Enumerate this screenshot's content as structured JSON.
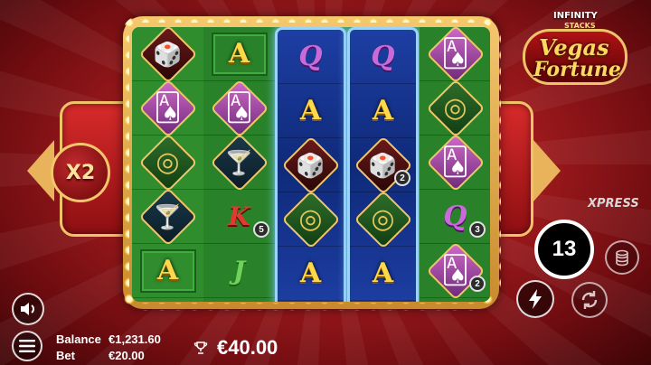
{
  "game": {
    "logo_infinity": "INFINITY",
    "logo_stacks": "STACKS",
    "logo_line1": "Vegas",
    "logo_line2": "Fortune",
    "multiplier": "X2",
    "xpress_label": "XPRESS",
    "spins_remaining": "13"
  },
  "reels": [
    [
      {
        "symbol": "dice",
        "glyph": "🎲"
      },
      {
        "symbol": "cards",
        "glyph": "🂡"
      },
      {
        "symbol": "roulette",
        "glyph": "◎"
      },
      {
        "symbol": "martini",
        "glyph": "🍸"
      },
      {
        "symbol": "A",
        "glyph": "A"
      }
    ],
    [
      {
        "symbol": "A",
        "glyph": "A"
      },
      {
        "symbol": "cards",
        "glyph": "🂡"
      },
      {
        "symbol": "martini",
        "glyph": "🍸"
      },
      {
        "symbol": "K",
        "glyph": "K",
        "stack": "5"
      },
      {
        "symbol": "J",
        "glyph": "J"
      }
    ],
    [
      {
        "symbol": "Q",
        "glyph": "Q"
      },
      {
        "symbol": "A",
        "glyph": "A"
      },
      {
        "symbol": "dice",
        "glyph": "🎲"
      },
      {
        "symbol": "roulette",
        "glyph": "◎"
      },
      {
        "symbol": "A",
        "glyph": "A"
      }
    ],
    [
      {
        "symbol": "Q",
        "glyph": "Q"
      },
      {
        "symbol": "A",
        "glyph": "A"
      },
      {
        "symbol": "dice",
        "glyph": "🎲",
        "stack": "2"
      },
      {
        "symbol": "roulette",
        "glyph": "◎"
      },
      {
        "symbol": "A",
        "glyph": "A"
      }
    ],
    [
      {
        "symbol": "cards",
        "glyph": "🂡"
      },
      {
        "symbol": "roulette",
        "glyph": "◎"
      },
      {
        "symbol": "cards",
        "glyph": "🂡"
      },
      {
        "symbol": "Q",
        "glyph": "Q",
        "stack": "3"
      },
      {
        "symbol": "cards",
        "glyph": "🂡",
        "stack": "2"
      }
    ]
  ],
  "footer": {
    "balance_label": "Balance",
    "balance_value": "€1,231.60",
    "bet_label": "Bet",
    "bet_value": "€20.00",
    "win_value": "€40.00"
  },
  "icons": {
    "sound": "speaker-icon",
    "menu": "menu-icon",
    "win": "trophy-icon",
    "coins": "coin-stack-icon",
    "turbo": "lightning-icon",
    "autoplay": "autoplay-icon"
  }
}
